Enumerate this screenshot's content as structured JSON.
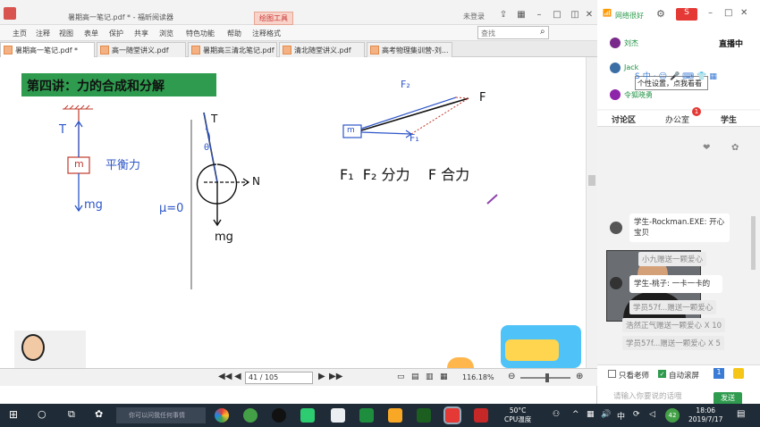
{
  "window": {
    "title": "暑期高一笔记.pdf * - 福昕阅读器",
    "badge": "绘图工具",
    "login": "未登录"
  },
  "menu": [
    "主页",
    "注释",
    "视图",
    "表单",
    "保护",
    "共享",
    "浏览",
    "特色功能",
    "帮助",
    "注释格式"
  ],
  "search_placeholder": "查找",
  "tabs": [
    {
      "label": "暑期高一笔记.pdf *"
    },
    {
      "label": "高一随堂讲义.pdf"
    },
    {
      "label": "暑期高三清北笔记.pdf"
    },
    {
      "label": "清北随堂讲义.pdf"
    },
    {
      "label": "高考物理集训营-刘..."
    }
  ],
  "note": {
    "heading": "第四讲：力的合成和分解",
    "labels": {
      "T1": "T",
      "m1": "m",
      "balance": "平衡力",
      "mg1": "mg",
      "T2": "T",
      "theta": "θ",
      "N": "N",
      "mu": "μ=0",
      "mg2": "mg",
      "F2": "F₂",
      "F": "F",
      "m3": "m",
      "F1": "F₁",
      "legend": "F₁  F₂ 分力    F 合力"
    }
  },
  "status": {
    "page": "41 / 105",
    "zoom": "116.18%"
  },
  "panel": {
    "network": "网络很好",
    "live": "直播中",
    "users": [
      "刘杰",
      "Jack",
      "令狐晓勇"
    ],
    "tooltip": "个性设置，点我看看",
    "tabs": [
      "讨论区",
      "办公室",
      "学生"
    ],
    "tab_badge": "1",
    "messages": [
      {
        "text": "学生-Rockman.EXE: 开心宝贝"
      },
      {
        "text": "学生-桃子: 一卡一卡的"
      }
    ],
    "gifts": [
      "小九赠送一颗爱心",
      "学员57f...赠送一颗爱心",
      "浩然正气赠送一颗爱心 X 10",
      "学员57f...赠送一颗爱心 X 5"
    ],
    "only_teacher": "只看老师",
    "auto_scroll": "自动滚屏",
    "input_placeholder": "请输入你要说的话哦",
    "send": "发送"
  },
  "taskbar": {
    "search": "你可以问我任何事情",
    "temp": "50°C",
    "temp_label": "CPU温度",
    "time": "18:06",
    "date": "2019/7/17",
    "ime": "中",
    "notif": "42"
  }
}
